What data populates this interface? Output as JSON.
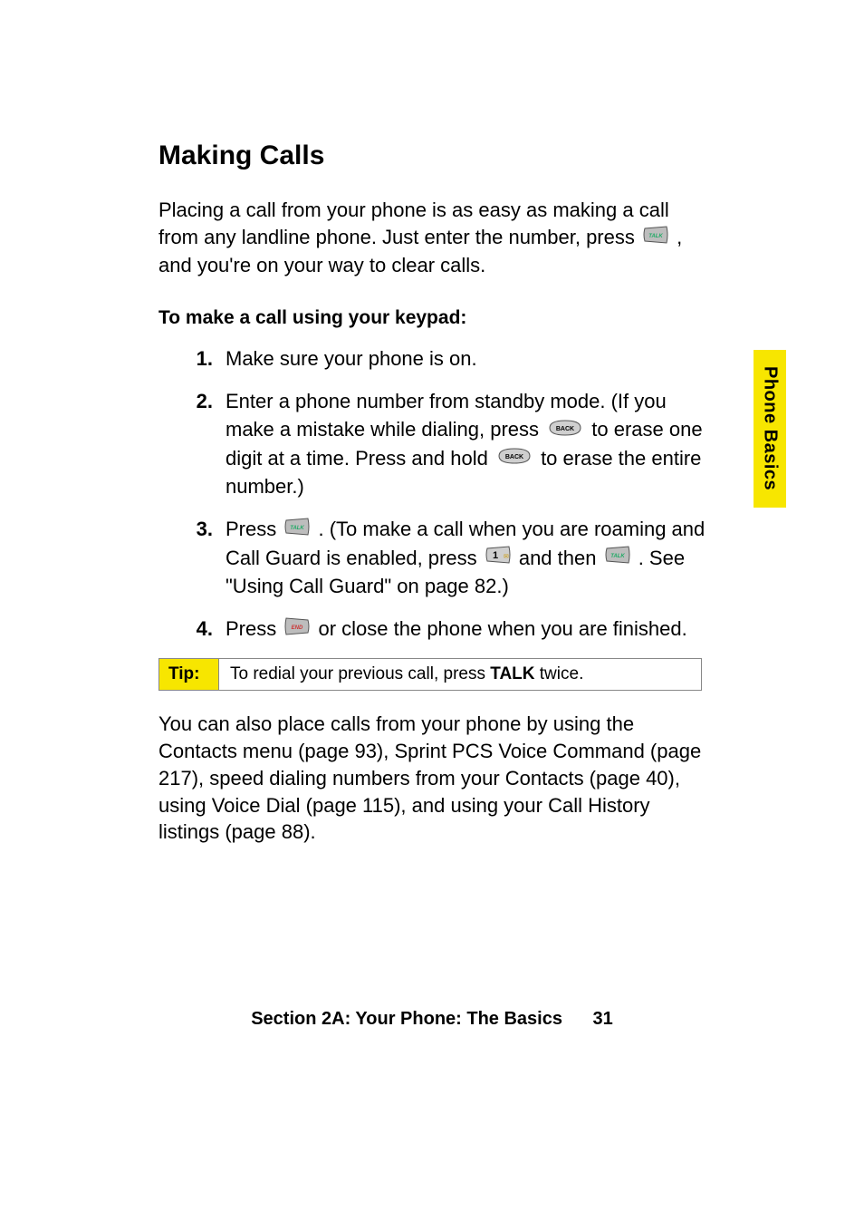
{
  "title": "Making Calls",
  "intro": {
    "part1": "Placing a call from your phone is as easy as making a call from any landline phone. Just enter the number, press ",
    "part2": ", and you're on your way to clear calls."
  },
  "subhead": "To make a call using your keypad:",
  "steps": {
    "s1": {
      "num": "1.",
      "text": "Make sure your phone is on."
    },
    "s2": {
      "num": "2.",
      "a": "Enter a phone number from standby mode. (If you make a mistake while dialing, press ",
      "b": " to erase one digit at a time. Press and hold ",
      "c": " to erase the entire number.)"
    },
    "s3": {
      "num": "3.",
      "a": "Press ",
      "b": ". (To make a call when you are roaming and Call Guard is enabled, press ",
      "c": " and then ",
      "d": ". See \"Using Call Guard\" on page 82.)"
    },
    "s4": {
      "num": "4.",
      "a": "Press ",
      "b": " or close the phone when you are finished."
    }
  },
  "tip": {
    "label": "Tip:",
    "before": "To redial your previous call, press ",
    "bold": "TALK",
    "after": " twice."
  },
  "outro": "You can also place calls from your phone by using the Contacts menu (page 93), Sprint PCS Voice Command (page 217), speed dialing numbers from your Contacts (page 40), using Voice Dial (page 115), and using your Call History listings (page 88).",
  "sidetab": "Phone Basics",
  "footer": {
    "section": "Section 2A: Your Phone: The Basics",
    "page": "31"
  },
  "icons": {
    "talk": "TALK",
    "back": "BACK",
    "one": "1",
    "end": "END"
  }
}
